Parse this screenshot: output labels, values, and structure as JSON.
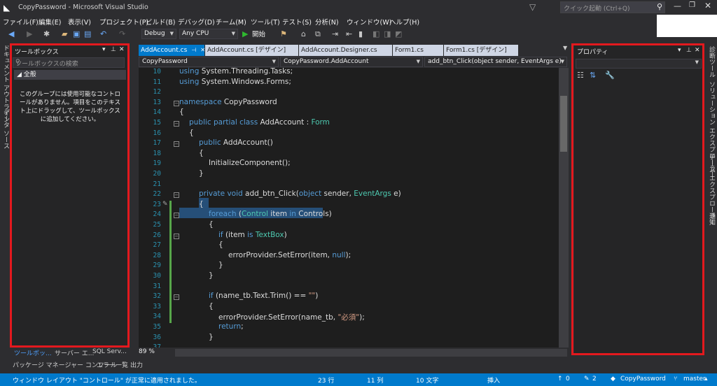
{
  "titlebar": {
    "title": "CopyPassword - Microsoft Visual Studio",
    "quick_launch_placeholder": "クイック起動 (Ctrl+Q)"
  },
  "menu": [
    "ファイル(F)",
    "編集(E)",
    "表示(V)",
    "プロジェクト(P)",
    "ビルド(B)",
    "デバッグ(D)",
    "チーム(M)",
    "ツール(T)",
    "テスト(S)",
    "分析(N)",
    "ウィンドウ(W)",
    "ヘルプ(H)"
  ],
  "toolbar": {
    "config": "Debug",
    "platform": "Any CPU",
    "start_label": "開始"
  },
  "left_strip_tabs": [
    "ドキュメント アウトライン",
    "データ ソース"
  ],
  "toolbox": {
    "title": "ツールボックス",
    "search_placeholder": "ツールボックスの検索",
    "group": "◢ 全般",
    "message": "このグループには使用可能なコントロールがありません。項目をこのテキスト上にドラッグして、ツールボックスに追加してください。",
    "bottom_tabs": [
      "ツールボッ...",
      "サーバー エ...",
      "SQL Serv..."
    ]
  },
  "bottom_tool_tabs": [
    "パッケージ マネージャー コンソール",
    "エラー一覧",
    "出力"
  ],
  "editor": {
    "tabs": [
      {
        "label": "AddAccount.cs",
        "active": true
      },
      {
        "label": "AddAccount.cs [デザイン]"
      },
      {
        "label": "AddAccount.Designer.cs"
      },
      {
        "label": "Form1.cs"
      },
      {
        "label": "Form1.cs [デザイン]"
      }
    ],
    "nav": [
      "CopyPassword",
      "CopyPassword.AddAccount",
      "add_btn_Click(object sender, EventArgs e)"
    ],
    "zoom": "89 %",
    "lines": [
      {
        "n": "10",
        "t": "using System.Threading.Tasks;"
      },
      {
        "n": "11",
        "t": "using System.Windows.Forms;"
      },
      {
        "n": "12",
        "t": ""
      },
      {
        "n": "13",
        "t": "namespace CopyPassword"
      },
      {
        "n": "14",
        "t": "{"
      },
      {
        "n": "15",
        "t": "public partial class AddAccount : Form"
      },
      {
        "n": "16",
        "t": "{"
      },
      {
        "n": "17",
        "t": "public AddAccount()"
      },
      {
        "n": "18",
        "t": "{"
      },
      {
        "n": "19",
        "t": "InitializeComponent();"
      },
      {
        "n": "20",
        "t": "}"
      },
      {
        "n": "21",
        "t": ""
      },
      {
        "n": "22",
        "t": "private void add_btn_Click(object sender, EventArgs e)"
      },
      {
        "n": "23",
        "t": "{"
      },
      {
        "n": "24",
        "t": "foreach (Control item in Controls)"
      },
      {
        "n": "25",
        "t": "{"
      },
      {
        "n": "26",
        "t": "if (item is TextBox)"
      },
      {
        "n": "27",
        "t": "{"
      },
      {
        "n": "28",
        "t": "errorProvider.SetError(item, null);"
      },
      {
        "n": "29",
        "t": "}"
      },
      {
        "n": "30",
        "t": "}"
      },
      {
        "n": "31",
        "t": ""
      },
      {
        "n": "32",
        "t": "if (name_tb.Text.Trim() == \"\")"
      },
      {
        "n": "33",
        "t": "{"
      },
      {
        "n": "34",
        "t": "errorProvider.SetError(name_tb, \"必須\");"
      },
      {
        "n": "35",
        "t": "return;"
      },
      {
        "n": "36",
        "t": "}"
      },
      {
        "n": "37",
        "t": ""
      }
    ]
  },
  "properties": {
    "title": "プロパティ"
  },
  "right_strip_tabs": [
    "診断ツール",
    "ソリューション エクスプローラー",
    "チーム エクスプローラー",
    "通知"
  ],
  "statusbar": {
    "message": "ウィンドウ レイアウト \"コントロール\" が正常に適用されました。",
    "line": "23 行",
    "col": "11 列",
    "chars": "10 文字",
    "mode": "挿入",
    "up": "0",
    "edits": "2",
    "project": "CopyPassword",
    "branch": "master"
  },
  "colors": {
    "accent": "#007acc",
    "highlight_border": "#e3191e",
    "keyword": "#569cd6",
    "type": "#4ec9b0",
    "string": "#d69d85"
  }
}
